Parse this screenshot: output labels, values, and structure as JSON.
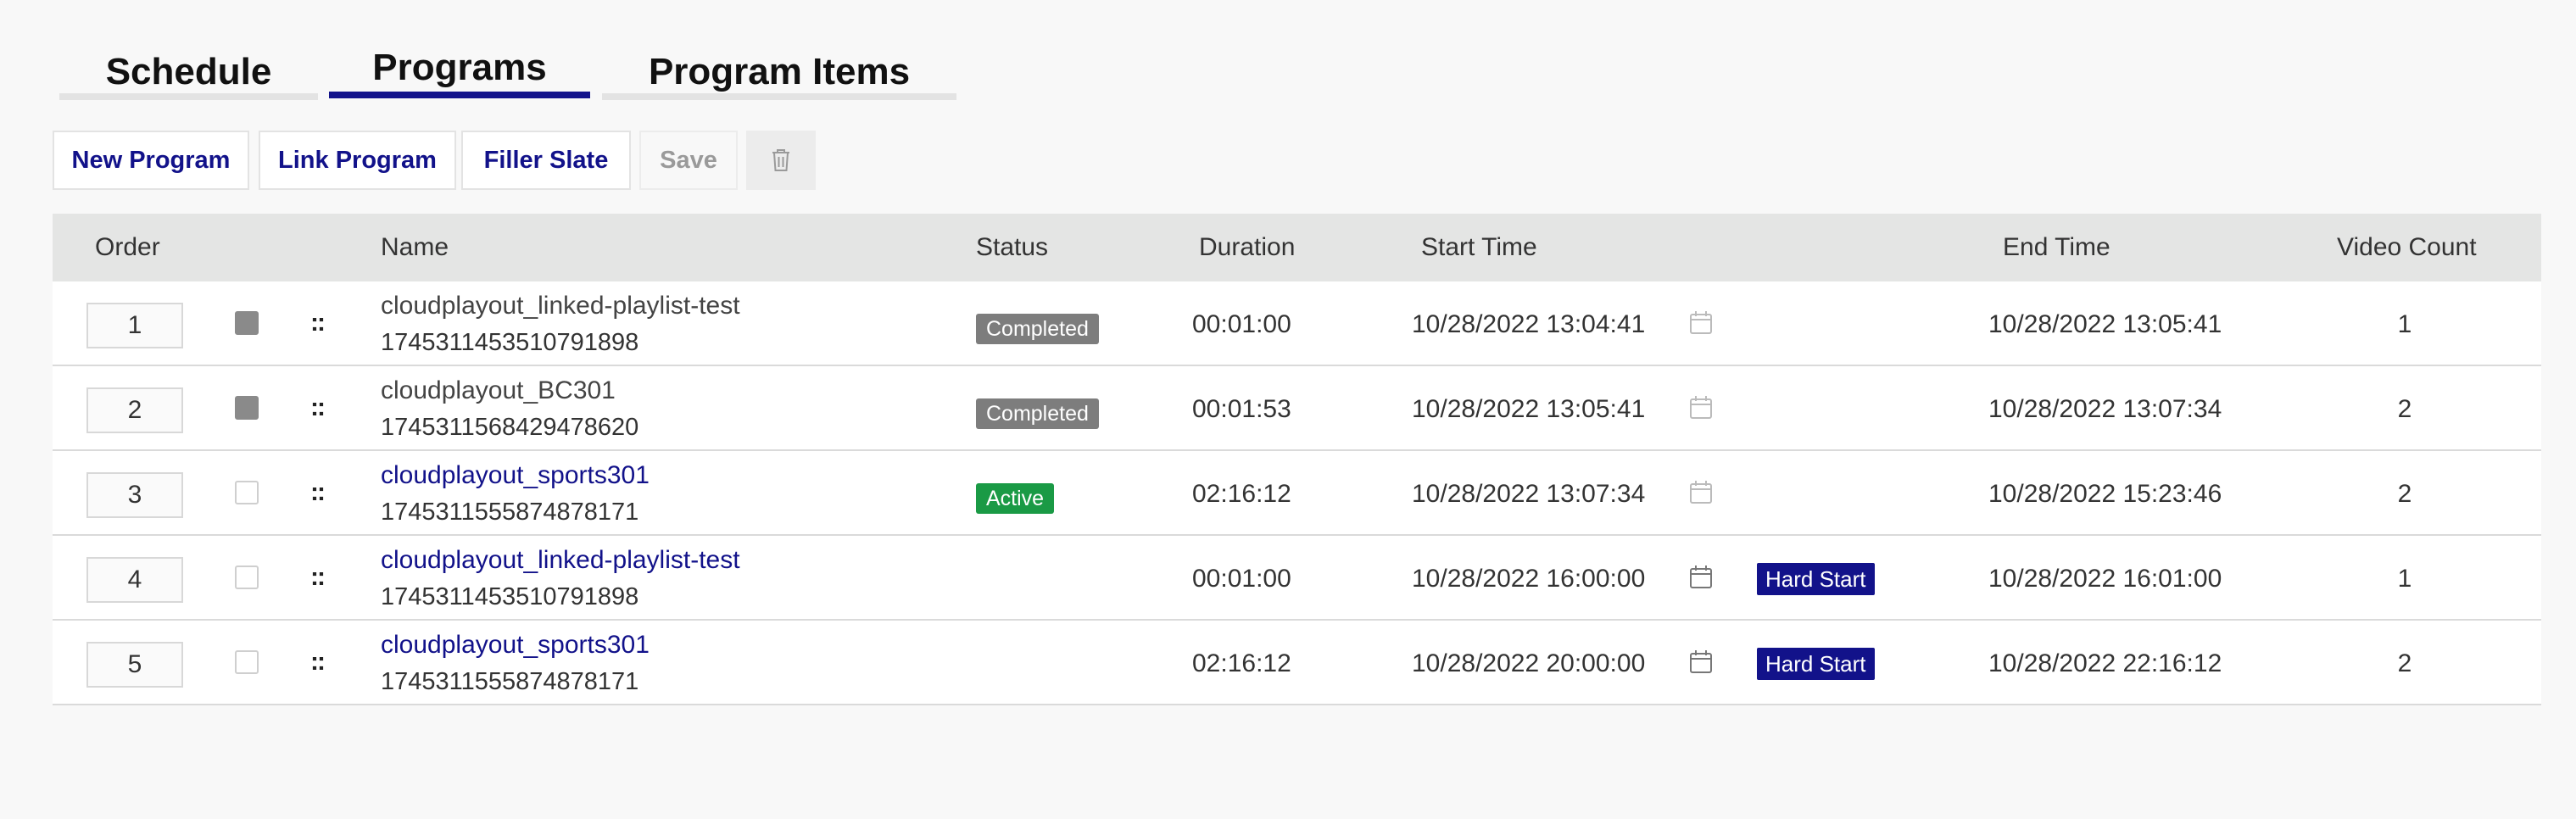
{
  "tabs": [
    {
      "label": "Schedule",
      "active": false
    },
    {
      "label": "Programs",
      "active": true
    },
    {
      "label": "Program Items",
      "active": false
    }
  ],
  "toolbar": {
    "new_program": "New Program",
    "link_program": "Link Program",
    "filler_slate": "Filler Slate",
    "save": "Save",
    "delete_icon": "trash-icon"
  },
  "table": {
    "columns": {
      "order": "Order",
      "name": "Name",
      "status": "Status",
      "duration": "Duration",
      "start_time": "Start Time",
      "end_time": "End Time",
      "video_count": "Video Count"
    },
    "rows": [
      {
        "order": "1",
        "checked": true,
        "name": "cloudplayout_linked-playlist-test",
        "id": "1745311453510791898",
        "name_link": false,
        "status": "Completed",
        "status_color": "#7d7d7d",
        "duration": "00:01:00",
        "start": "10/28/2022 13:04:41",
        "hard_start": "",
        "end": "10/28/2022 13:05:41",
        "count": "1"
      },
      {
        "order": "2",
        "checked": true,
        "name": "cloudplayout_BC301",
        "id": "1745311568429478620",
        "name_link": false,
        "status": "Completed",
        "status_color": "#7d7d7d",
        "duration": "00:01:53",
        "start": "10/28/2022 13:05:41",
        "hard_start": "",
        "end": "10/28/2022 13:07:34",
        "count": "2"
      },
      {
        "order": "3",
        "checked": false,
        "name": "cloudplayout_sports301",
        "id": "1745311555874878171",
        "name_link": true,
        "status": "Active",
        "status_color": "#1a9a45",
        "duration": "02:16:12",
        "start": "10/28/2022 13:07:34",
        "hard_start": "",
        "end": "10/28/2022 15:23:46",
        "count": "2"
      },
      {
        "order": "4",
        "checked": false,
        "name": "cloudplayout_linked-playlist-test",
        "id": "1745311453510791898",
        "name_link": true,
        "status": "",
        "status_color": "",
        "duration": "00:01:00",
        "start": "10/28/2022 16:00:00",
        "hard_start": "Hard Start",
        "end": "10/28/2022 16:01:00",
        "count": "1"
      },
      {
        "order": "5",
        "checked": false,
        "name": "cloudplayout_sports301",
        "id": "1745311555874878171",
        "name_link": true,
        "status": "",
        "status_color": "",
        "duration": "02:16:12",
        "start": "10/28/2022 20:00:00",
        "hard_start": "Hard Start",
        "end": "10/28/2022 22:16:12",
        "count": "2"
      }
    ]
  },
  "colors": {
    "accent": "#12128a",
    "header_bg": "#e4e5e4"
  }
}
